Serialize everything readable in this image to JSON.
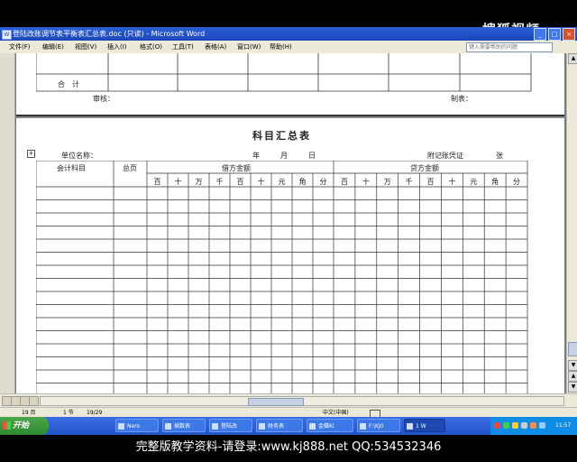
{
  "watermark": "搜狐视频",
  "window": {
    "title": "登陆改账调节表平衡表汇总表.doc (只读) - Microsoft Word",
    "icon": "W"
  },
  "menu": [
    "文件(F)",
    "编辑(E)",
    "视图(V)",
    "插入(I)",
    "格式(O)",
    "工具(T)",
    "表格(A)",
    "窗口(W)",
    "帮助(H)"
  ],
  "help_placeholder": "键入需要帮助的问题",
  "prev_page": {
    "total_label": "合　计",
    "reviewer": "审核：",
    "preparer": "制表："
  },
  "form": {
    "title": "科目汇总表",
    "unit_name": "单位名称：",
    "date": [
      "年",
      "月",
      "日"
    ],
    "attached": "附记账凭证",
    "sheets": "张",
    "col_account": "会计科目",
    "col_ledger": "总页",
    "debit": "借方金额",
    "credit": "贷方金额",
    "digits": [
      "百",
      "十",
      "万",
      "千",
      "百",
      "十",
      "元",
      "角",
      "分"
    ]
  },
  "status": {
    "page": "19 页",
    "section": "1 节",
    "pages": "19/29",
    "lang": "中文(中国)"
  },
  "taskbar": {
    "start": "开始",
    "tasks": [
      "Nero",
      "插数表",
      "登陆改",
      "财务表",
      "金蝶KI",
      "F:\\KJ0",
      "1 W"
    ]
  },
  "tray": {
    "time": "11:57"
  },
  "banner": "完整版教学资料-请登录:www.kj888.net QQ:534532346"
}
